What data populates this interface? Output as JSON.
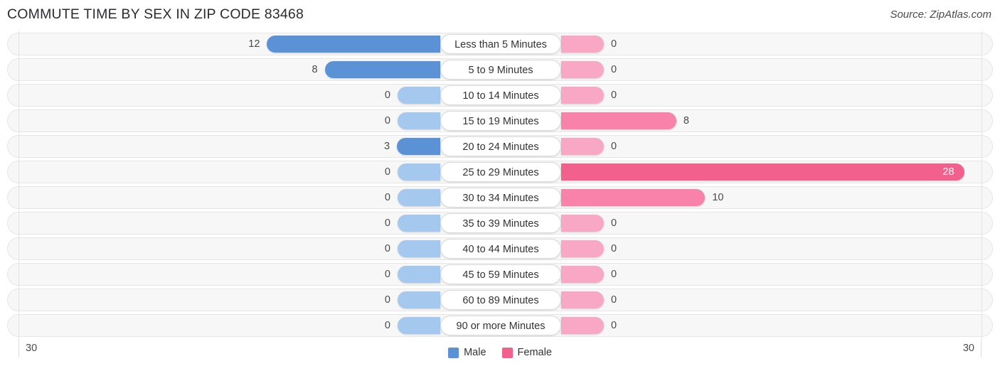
{
  "header": {
    "title": "COMMUTE TIME BY SEX IN ZIP CODE 83468",
    "source": "Source: ZipAtlas.com"
  },
  "legend": {
    "male_label": "Male",
    "female_label": "Female",
    "male_color": "#5b92d6",
    "female_color": "#f2608e"
  },
  "axis": {
    "left_label": "30",
    "right_label": "30",
    "max": 30
  },
  "colors": {
    "male": "#5b92d6",
    "male_zero": "#a5c8ee",
    "female": "#f2608e",
    "female_zero": "#f8a8c4",
    "female_mid": "#f882a9",
    "track": "#f7f7f7"
  },
  "chart_data": {
    "type": "bar",
    "title": "COMMUTE TIME BY SEX IN ZIP CODE 83468",
    "xlabel": "",
    "ylabel": "",
    "orientation": "horizontal-diverging",
    "xlim": [
      30,
      30
    ],
    "grid": false,
    "legend_position": "bottom-center",
    "categories": [
      "Less than 5 Minutes",
      "5 to 9 Minutes",
      "10 to 14 Minutes",
      "15 to 19 Minutes",
      "20 to 24 Minutes",
      "25 to 29 Minutes",
      "30 to 34 Minutes",
      "35 to 39 Minutes",
      "40 to 44 Minutes",
      "45 to 59 Minutes",
      "60 to 89 Minutes",
      "90 or more Minutes"
    ],
    "series": [
      {
        "name": "Male",
        "values": [
          12,
          8,
          0,
          0,
          3,
          0,
          0,
          0,
          0,
          0,
          0,
          0
        ]
      },
      {
        "name": "Female",
        "values": [
          0,
          0,
          0,
          8,
          0,
          28,
          10,
          0,
          0,
          0,
          0,
          0
        ]
      }
    ]
  },
  "rows": [
    {
      "label": "Less than 5 Minutes",
      "male": "12",
      "female": "0"
    },
    {
      "label": "5 to 9 Minutes",
      "male": "8",
      "female": "0"
    },
    {
      "label": "10 to 14 Minutes",
      "male": "0",
      "female": "0"
    },
    {
      "label": "15 to 19 Minutes",
      "male": "0",
      "female": "8"
    },
    {
      "label": "20 to 24 Minutes",
      "male": "3",
      "female": "0"
    },
    {
      "label": "25 to 29 Minutes",
      "male": "0",
      "female": "28"
    },
    {
      "label": "30 to 34 Minutes",
      "male": "0",
      "female": "10"
    },
    {
      "label": "35 to 39 Minutes",
      "male": "0",
      "female": "0"
    },
    {
      "label": "40 to 44 Minutes",
      "male": "0",
      "female": "0"
    },
    {
      "label": "45 to 59 Minutes",
      "male": "0",
      "female": "0"
    },
    {
      "label": "60 to 89 Minutes",
      "male": "0",
      "female": "0"
    },
    {
      "label": "90 or more Minutes",
      "male": "0",
      "female": "0"
    }
  ]
}
